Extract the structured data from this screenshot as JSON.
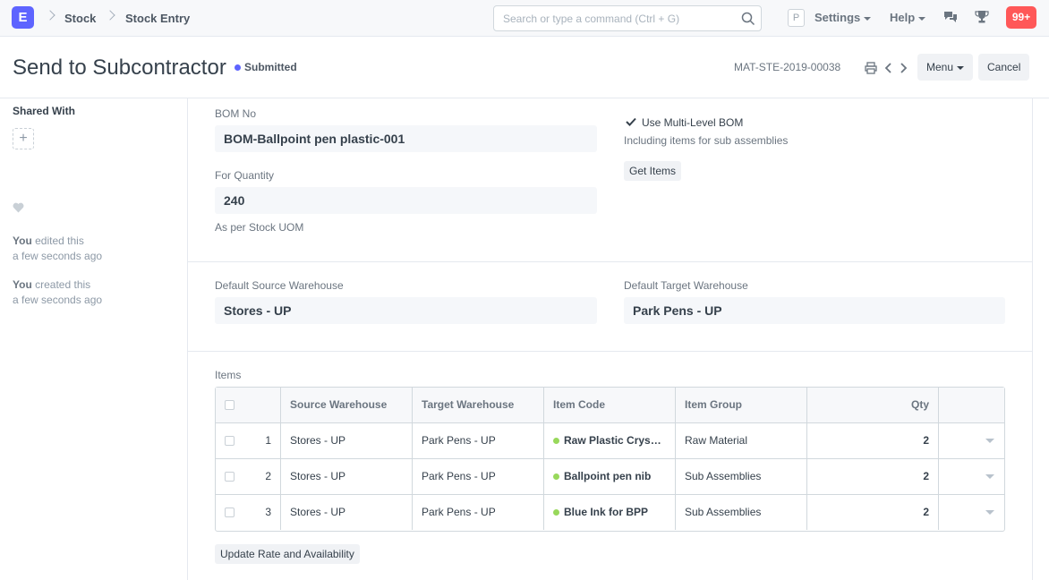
{
  "navbar": {
    "logo": "E",
    "breadcrumbs": [
      "Stock",
      "Stock Entry"
    ],
    "search_placeholder": "Search or type a command (Ctrl + G)",
    "user_initial": "P",
    "settings_label": "Settings",
    "help_label": "Help",
    "notifications": "99+"
  },
  "page": {
    "title": "Send to Subcontractor",
    "status": "Submitted",
    "doc_name": "MAT-STE-2019-00038",
    "menu_label": "Menu",
    "cancel_label": "Cancel"
  },
  "sidebar": {
    "shared_with_label": "Shared With",
    "add_icon": "+",
    "activity": [
      {
        "user": "You",
        "action": "edited this",
        "time": "a few seconds ago"
      },
      {
        "user": "You",
        "action": "created this",
        "time": "a few seconds ago"
      }
    ]
  },
  "form": {
    "bom_no_label": "BOM No",
    "bom_no_value": "BOM-Ballpoint pen plastic-001",
    "for_quantity_label": "For Quantity",
    "for_quantity_value": "240",
    "for_quantity_help": "As per Stock UOM",
    "multi_level_label": "Use Multi-Level BOM",
    "multi_level_help": "Including items for sub assemblies",
    "multi_level_checked": true,
    "get_items_label": "Get Items",
    "source_wh_label": "Default Source Warehouse",
    "source_wh_value": "Stores - UP",
    "target_wh_label": "Default Target Warehouse",
    "target_wh_value": "Park Pens - UP",
    "items_label": "Items",
    "update_rate_label": "Update Rate and Availability"
  },
  "items_table": {
    "headers": [
      "Source Warehouse",
      "Target Warehouse",
      "Item Code",
      "Item Group",
      "Qty"
    ],
    "rows": [
      {
        "idx": "1",
        "source": "Stores - UP",
        "target": "Park Pens - UP",
        "item_code": "Raw Plastic Crys…",
        "item_group": "Raw Material",
        "qty": "2"
      },
      {
        "idx": "2",
        "source": "Stores - UP",
        "target": "Park Pens - UP",
        "item_code": "Ballpoint pen nib",
        "item_group": "Sub Assemblies",
        "qty": "2"
      },
      {
        "idx": "3",
        "source": "Stores - UP",
        "target": "Park Pens - UP",
        "item_code": "Blue Ink for BPP",
        "item_group": "Sub Assemblies",
        "qty": "2"
      }
    ]
  },
  "colors": {
    "accent": "#5e64ff",
    "notification": "#ff5858",
    "item_dot": "#98d85b"
  },
  "icons": [
    "search-icon",
    "chat-icon",
    "trophy-icon",
    "print-icon",
    "chevron-left-icon",
    "chevron-right-icon",
    "heart-icon",
    "check-icon",
    "plus-icon"
  ]
}
